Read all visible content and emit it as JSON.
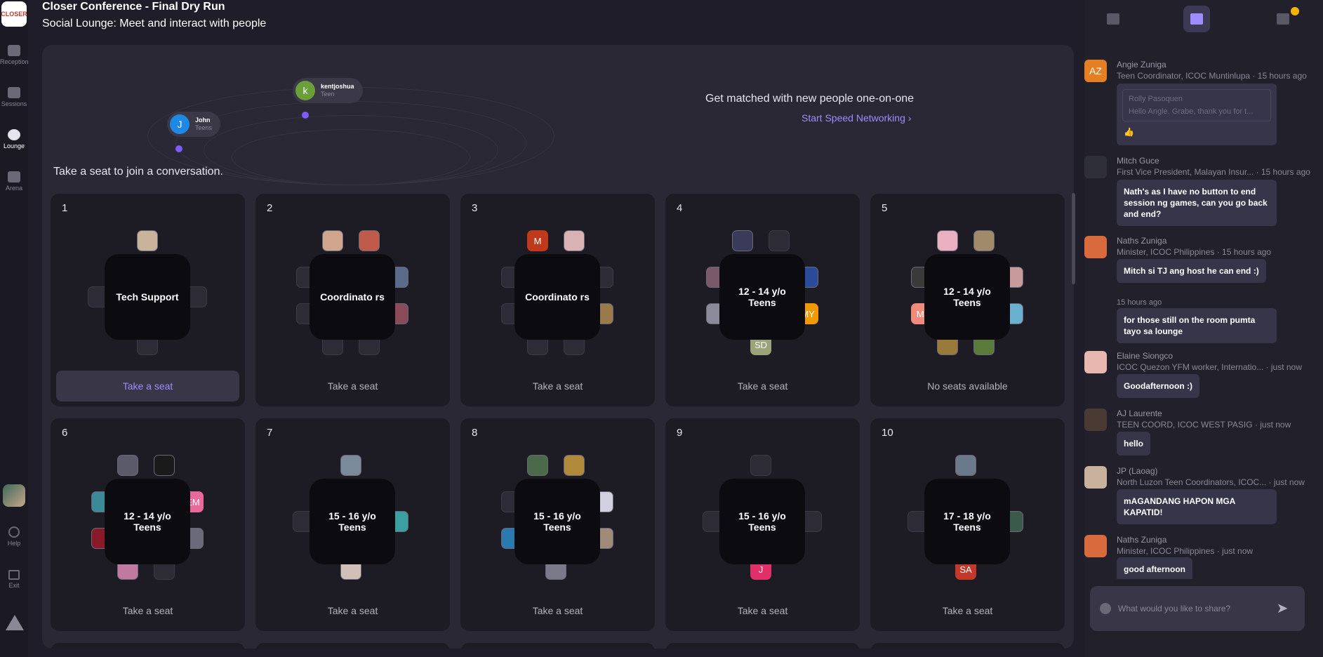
{
  "nav": {
    "logo_text": "CLOSER",
    "items": [
      {
        "label": "Reception"
      },
      {
        "label": "Sessions"
      },
      {
        "label": "Lounge"
      },
      {
        "label": "Arena"
      }
    ],
    "help": "Help",
    "exit": "Exit"
  },
  "header": {
    "title": "Closer Conference - Final Dry Run",
    "subtitle": "Social Lounge: Meet and interact with people"
  },
  "hero": {
    "users": [
      {
        "initial": "J",
        "name": "John",
        "role": "Teens",
        "color": "#1e88e5"
      },
      {
        "initial": "k",
        "name": "kentjoshua",
        "role": "Teen",
        "color": "#6a9f3a"
      }
    ],
    "pitch": "Get matched with new people one-on-one",
    "speed_link": "Start Speed Networking"
  },
  "prompt": "Take a seat to join a conversation.",
  "tables": [
    {
      "num": "1",
      "name": "Tech Support",
      "action": "Take a seat"
    },
    {
      "num": "2",
      "name": "Coordinato rs",
      "action": "Take a seat"
    },
    {
      "num": "3",
      "name": "Coordinato rs",
      "action": "Take a seat"
    },
    {
      "num": "4",
      "name": "12 - 14 y/o Teens",
      "action": "Take a seat"
    },
    {
      "num": "5",
      "name": "12 - 14 y/o Teens",
      "action": "No seats available"
    },
    {
      "num": "6",
      "name": "12 - 14 y/o Teens",
      "action": "Take a seat"
    },
    {
      "num": "7",
      "name": "15 - 16 y/o Teens",
      "action": "Take a seat"
    },
    {
      "num": "8",
      "name": "15 - 16 y/o Teens",
      "action": "Take a seat"
    },
    {
      "num": "9",
      "name": "15 - 16 y/o Teens",
      "action": "Take a seat"
    },
    {
      "num": "10",
      "name": "17 - 18 y/o Teens",
      "action": "Take a seat"
    }
  ],
  "seat_initials": {
    "t3": "M",
    "t4a": "MY",
    "t4b": "SD",
    "t5": "MI",
    "t6": "EM",
    "t9": "J",
    "t10": "SA"
  },
  "chat": {
    "messages": [
      {
        "initials": "AZ",
        "avatar_color": "#e67e22",
        "name": "Angie Zuniga",
        "meta": "Teen Coordinator, ICOC Muntinlupa · 15 hours ago",
        "quote_name": "Rolly Pasoquen",
        "quote_text": "Hello Angle. Grabe, thank you for t...",
        "text": "👍"
      },
      {
        "initials": "",
        "avatar_color": "#2f2f3a",
        "name": "Mitch Guce",
        "meta": "First Vice President, Malayan Insur... · 15 hours ago",
        "text": "Nath's as I have no button to end session ng games, can you go back and end?"
      },
      {
        "initials": "",
        "avatar_color": "#d86a3d",
        "name": "Naths Zuniga",
        "meta": "Minister, ICOC Philippines · 15 hours ago",
        "text": "Mitch si TJ ang host he can end :)"
      },
      {
        "time": "15 hours ago",
        "text": "for those still on the room pumta tayo sa lounge"
      },
      {
        "initials": "",
        "avatar_color": "#e8b7b0",
        "name": "Elaine Siongco",
        "meta": "ICOC Quezon YFM worker, Internatio... · just now",
        "text": "Goodafternoon :)"
      },
      {
        "initials": "",
        "avatar_color": "#4a3a34",
        "name": "AJ Laurente",
        "meta": "TEEN COORD, ICOC WEST PASIG · just now",
        "text": "hello"
      },
      {
        "initials": "",
        "avatar_color": "#c9b19d",
        "name": "JP (Laoag)",
        "meta": "North Luzon Teen Coordinators, ICOC... · just now",
        "text": "mAGANDANG HAPON MGA KAPATID!"
      },
      {
        "initials": "",
        "avatar_color": "#d86a3d",
        "name": "Naths Zuniga",
        "meta": "Minister, ICOC Philippines · just now",
        "text": "good afternoon"
      }
    ],
    "placeholder": "What would you like to share?"
  },
  "colors": {
    "accent": "#9f8cff",
    "background": "#1f1d29",
    "card": "#1d1c25",
    "table": "#0c0c10"
  }
}
